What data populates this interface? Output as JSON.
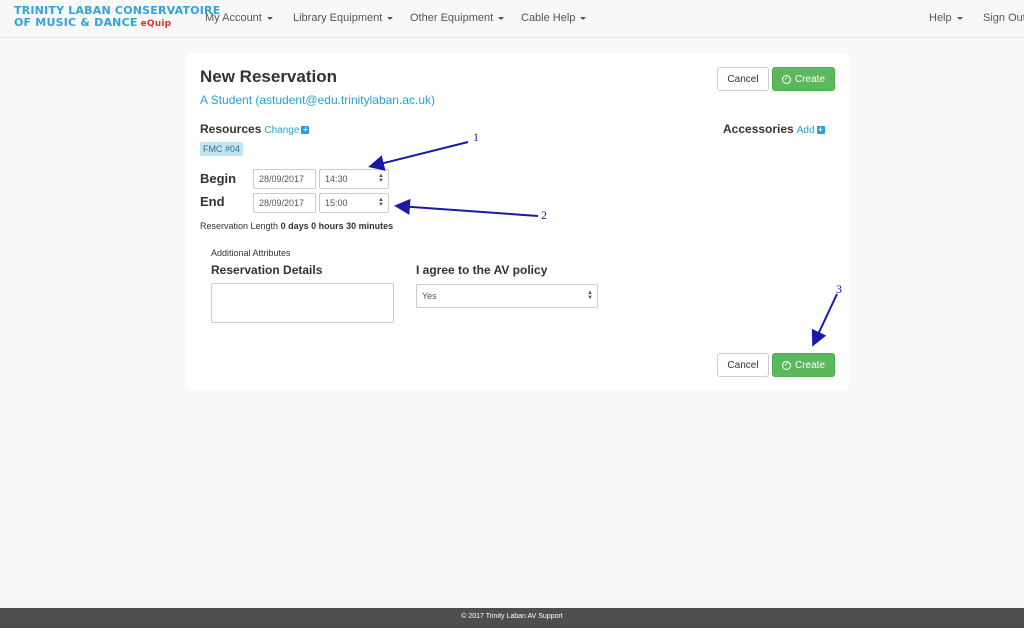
{
  "navbar": {
    "brand_line1": "TRINITY LABAN CONSERVATOIRE",
    "brand_line2": "OF MUSIC & DANCE",
    "brand_suffix": "eQuip",
    "items": [
      {
        "label": "My Account"
      },
      {
        "label": "Library Equipment"
      },
      {
        "label": "Other Equipment"
      },
      {
        "label": "Cable Help"
      }
    ],
    "right_items": [
      {
        "label": "Help"
      },
      {
        "label": "Sign Out"
      }
    ]
  },
  "reservation": {
    "title": "New Reservation",
    "user": "A Student (astudent@edu.trinitylaban.ac.uk)",
    "cancel_label": "Cancel",
    "create_label": "Create",
    "resources_label": "Resources",
    "resources_change": "Change",
    "resource_tag": "FMC #04",
    "accessories_label": "Accessories",
    "accessories_add": "Add",
    "begin_label": "Begin",
    "begin_date": "28/09/2017",
    "begin_time": "14:30",
    "end_label": "End",
    "end_date": "28/09/2017",
    "end_time": "15:00",
    "length_label": "Reservation Length",
    "length_value": "0 days 0 hours 30 minutes",
    "additional_attributes": "Additional Attributes",
    "details_label": "Reservation Details",
    "policy_label": "I agree to the AV policy",
    "policy_value": "Yes"
  },
  "annotations": {
    "one": "1",
    "two": "2",
    "three": "3"
  },
  "colors": {
    "primary": "#2a9fd6",
    "success": "#5cb85c",
    "annotation": "#1a1aaa"
  },
  "footer": {
    "text": "© 2017 Trinity Laban AV Support"
  }
}
